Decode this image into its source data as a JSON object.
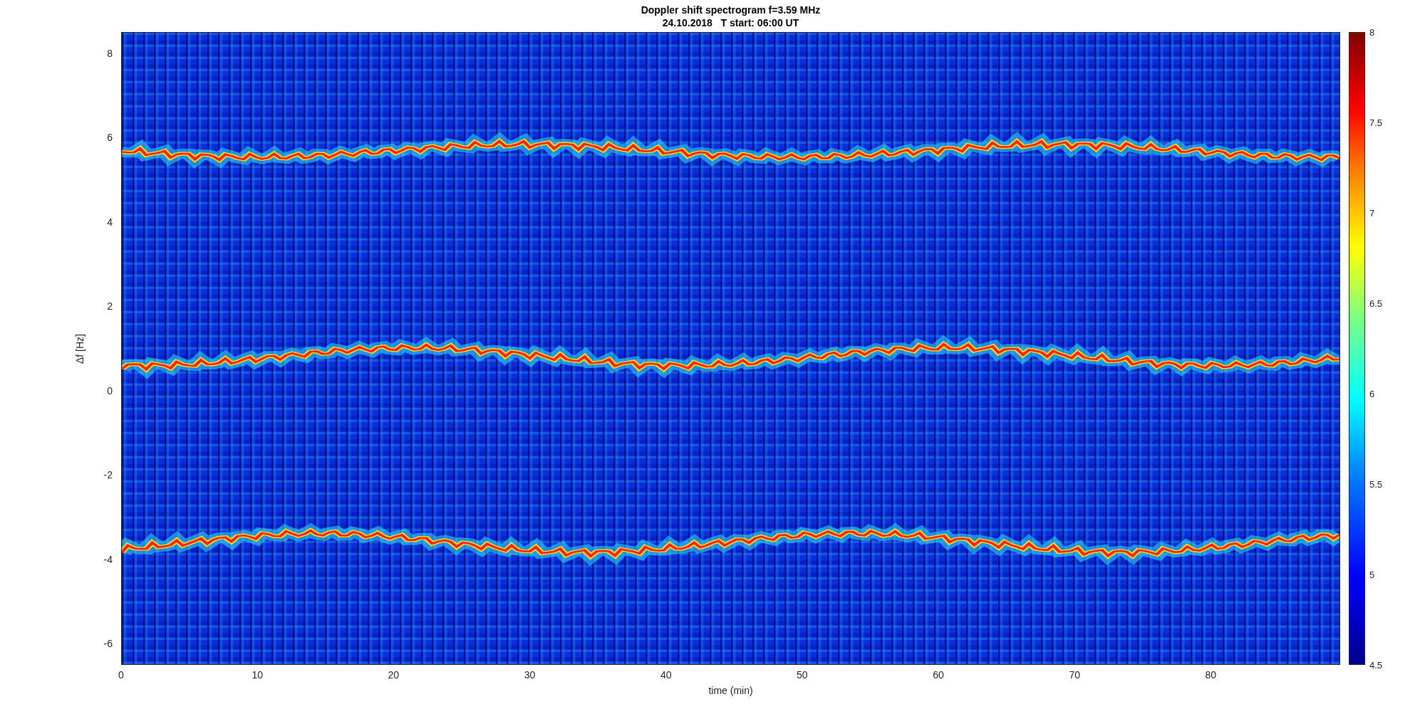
{
  "figure": {
    "title": "Doppler shift spectrogram f=3.59 MHz",
    "subtitle": "24.10.2018   T start: 06:00 UT"
  },
  "axes": {
    "ylabel": "Δf [Hz]",
    "xlabel": "time (min)",
    "yticks": [
      "8",
      "6",
      "4",
      "2",
      "0",
      "-2",
      "-4",
      "-6"
    ],
    "xticks": [
      "0",
      "10",
      "20",
      "30",
      "40",
      "50",
      "60",
      "70",
      "80"
    ]
  },
  "colorbar": {
    "ticks": [
      "8",
      "7.5",
      "7",
      "6.5",
      "6",
      "5.5",
      "5",
      "4.5"
    ]
  }
}
